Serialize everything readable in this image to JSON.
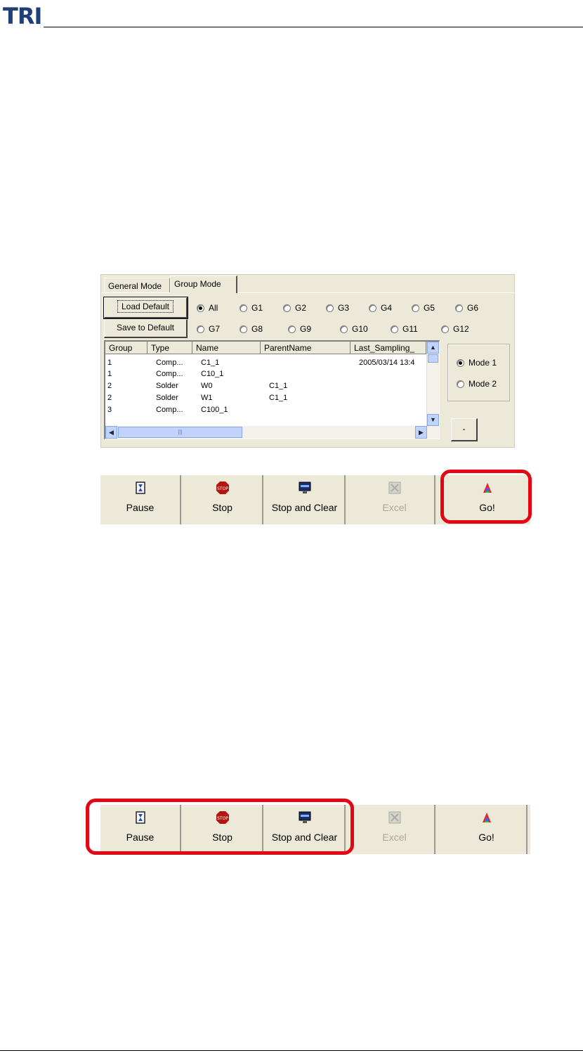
{
  "logo": "TRI",
  "tabs": {
    "general": "General Mode",
    "group": "Group Mode"
  },
  "buttons": {
    "load_default": "Load Default",
    "save_default": "Save to Default",
    "dash": "-"
  },
  "group_radios": {
    "row1": [
      "All",
      "G1",
      "G2",
      "G3",
      "G4",
      "G5",
      "G6"
    ],
    "row2": [
      "G7",
      "G8",
      "G9",
      "G10",
      "G11",
      "G12"
    ],
    "selected": "All"
  },
  "table": {
    "headers": [
      "Group",
      "Type",
      "Name",
      "ParentName",
      "Last_Sampling_"
    ],
    "rows": [
      [
        "1",
        "Comp...",
        "C1_1",
        "",
        "2005/03/14 13:4"
      ],
      [
        "1",
        "Comp...",
        "C10_1",
        "",
        ""
      ],
      [
        "2",
        "Solder",
        "W0",
        "C1_1",
        ""
      ],
      [
        "2",
        "Solder",
        "W1",
        "C1_1",
        ""
      ],
      [
        "3",
        "Comp...",
        "C100_1",
        "",
        ""
      ]
    ]
  },
  "modes": {
    "items": [
      "Mode 1",
      "Mode 2"
    ],
    "selected": "Mode 1"
  },
  "toolbar": {
    "buttons": [
      {
        "label": "Pause",
        "icon": "hourglass-icon",
        "enabled": true
      },
      {
        "label": "Stop",
        "icon": "stop-sign-icon",
        "enabled": true
      },
      {
        "label": "Stop and Clear",
        "icon": "monitor-icon",
        "enabled": true
      },
      {
        "label": "Excel",
        "icon": "excel-icon",
        "enabled": false
      },
      {
        "label": "Go!",
        "icon": "go-icon",
        "enabled": true
      }
    ]
  },
  "colors": {
    "highlight": "#e30613",
    "window_bg": "#ece9d8",
    "logo": "#1f3f77"
  }
}
